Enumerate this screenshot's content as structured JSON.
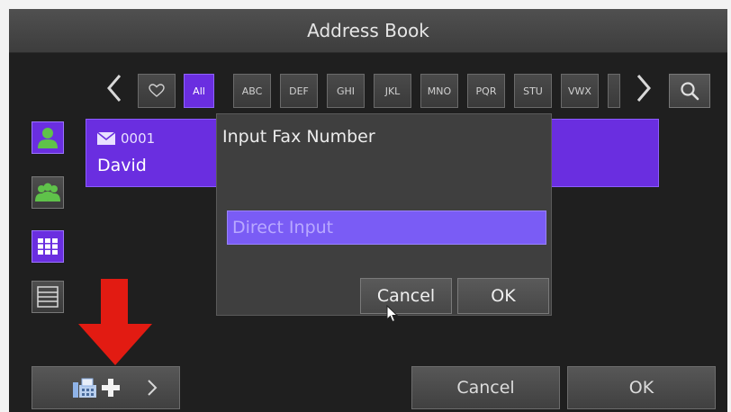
{
  "header": {
    "title": "Address Book"
  },
  "filter": {
    "prev_icon": "chevron-left-icon",
    "next_icon": "chevron-right-icon",
    "favorites_icon": "heart-icon",
    "tabs": [
      "All",
      "ABC",
      "DEF",
      "GHI",
      "JKL",
      "MNO",
      "PQR",
      "STU",
      "VWX"
    ],
    "active_tab": "All",
    "search_icon": "search-icon"
  },
  "sidebar": {
    "buttons": [
      {
        "icon": "single-contact-icon",
        "active": true
      },
      {
        "icon": "group-icon",
        "active": false
      },
      {
        "icon": "grid-view-icon",
        "active": true
      },
      {
        "icon": "list-view-icon",
        "active": false
      }
    ]
  },
  "contact": {
    "number": "0001",
    "name": "David",
    "icon": "envelope-icon"
  },
  "dialog": {
    "title": "Input Fax Number",
    "input_placeholder": "Direct Input",
    "cancel_label": "Cancel",
    "ok_label": "OK"
  },
  "footer": {
    "add_fax_icon": "fax-icon",
    "cancel_label": "Cancel",
    "ok_label": "OK"
  },
  "colors": {
    "accent": "#6a2ee0",
    "arrow": "#e21b12"
  }
}
